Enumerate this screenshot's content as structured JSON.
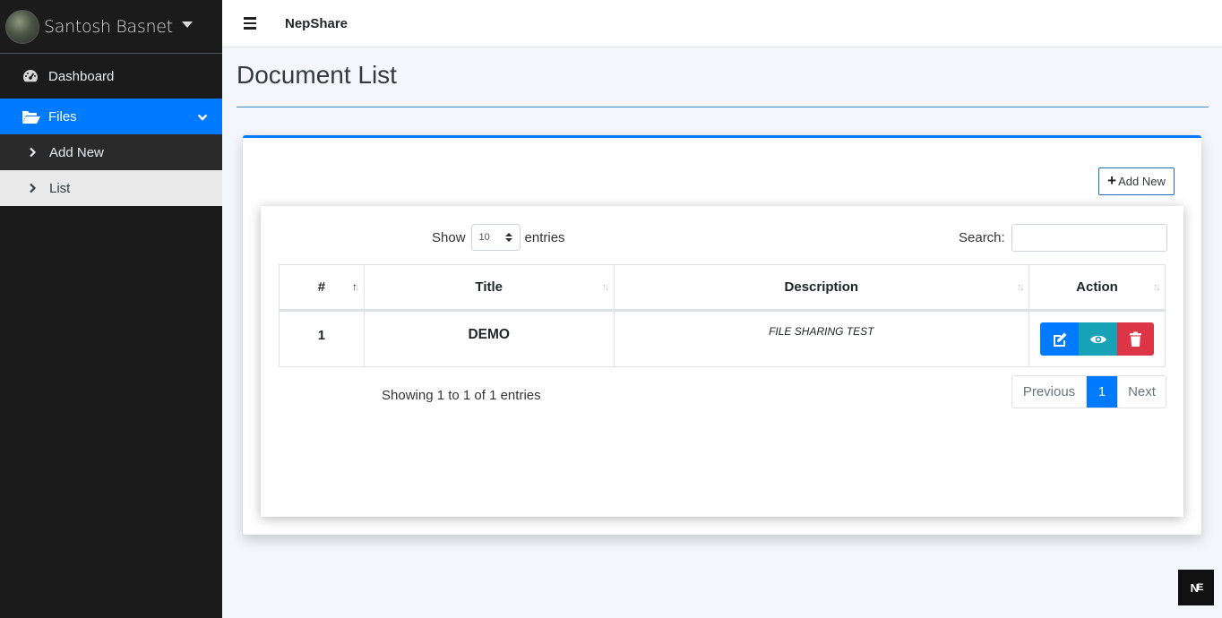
{
  "sidebar": {
    "user_name": "Santosh Basnet",
    "items": [
      {
        "label": "Dashboard",
        "icon": "tachometer-icon"
      },
      {
        "label": "Files",
        "icon": "folder-open-icon",
        "active": true
      },
      {
        "label": "Add New",
        "icon": "chevron-right-icon"
      },
      {
        "label": "List",
        "icon": "chevron-right-icon"
      }
    ]
  },
  "topbar": {
    "brand": "NepShare"
  },
  "page": {
    "title": "Document List"
  },
  "card": {
    "add_button_label": "Add New",
    "show_label": "Show",
    "entries_label": "entries",
    "page_length": "10",
    "search_label": "Search:",
    "search_value": "",
    "columns": [
      "#",
      "Title",
      "Description",
      "Action"
    ],
    "rows": [
      {
        "num": "1",
        "title": "DEMO",
        "description": "FILE SHARING TEST"
      }
    ],
    "info": "Showing 1 to 1 of 1 entries",
    "pagination": {
      "previous": "Previous",
      "current": "1",
      "next": "Next"
    }
  },
  "corner_logo": {
    "main": "N",
    "sub": "E"
  },
  "colors": {
    "primary": "#007bff",
    "info": "#17a2b8",
    "danger": "#dc3545",
    "sidebar_bg": "#1b1b1b"
  }
}
